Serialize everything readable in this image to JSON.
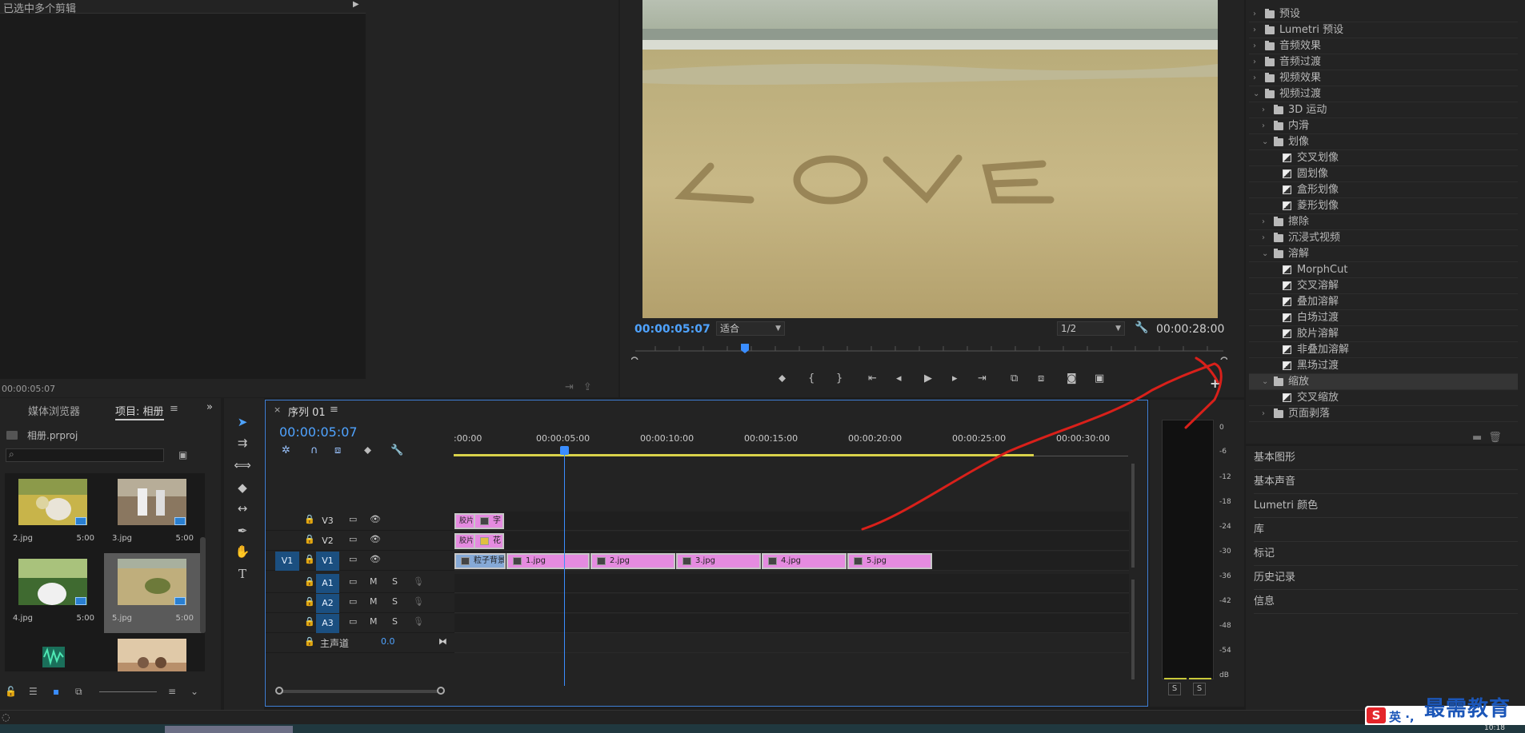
{
  "source_monitor": {
    "title": "已选中多个剪辑",
    "timecode": "00:00:05:07"
  },
  "program_monitor": {
    "timecode": "00:00:05:07",
    "fit": "适合",
    "resolution": "1/2",
    "duration": "00:00:28:00"
  },
  "effects": {
    "items": [
      {
        "label": "预设",
        "level": 0,
        "open": false,
        "type": "folder"
      },
      {
        "label": "Lumetri 预设",
        "level": 0,
        "open": false,
        "type": "folder"
      },
      {
        "label": "音频效果",
        "level": 0,
        "open": false,
        "type": "folder"
      },
      {
        "label": "音频过渡",
        "level": 0,
        "open": false,
        "type": "folder"
      },
      {
        "label": "视频效果",
        "level": 0,
        "open": false,
        "type": "folder"
      },
      {
        "label": "视频过渡",
        "level": 0,
        "open": true,
        "type": "folder"
      },
      {
        "label": "3D 运动",
        "level": 1,
        "open": false,
        "type": "folder"
      },
      {
        "label": "内滑",
        "level": 1,
        "open": false,
        "type": "folder"
      },
      {
        "label": "划像",
        "level": 1,
        "open": true,
        "type": "folder"
      },
      {
        "label": "交叉划像",
        "level": 2,
        "type": "transition"
      },
      {
        "label": "圆划像",
        "level": 2,
        "type": "transition"
      },
      {
        "label": "盒形划像",
        "level": 2,
        "type": "transition"
      },
      {
        "label": "菱形划像",
        "level": 2,
        "type": "transition"
      },
      {
        "label": "擦除",
        "level": 1,
        "open": false,
        "type": "folder"
      },
      {
        "label": "沉浸式视频",
        "level": 1,
        "open": false,
        "type": "folder"
      },
      {
        "label": "溶解",
        "level": 1,
        "open": true,
        "type": "folder"
      },
      {
        "label": "MorphCut",
        "level": 2,
        "type": "transition"
      },
      {
        "label": "交叉溶解",
        "level": 2,
        "type": "transition"
      },
      {
        "label": "叠加溶解",
        "level": 2,
        "type": "transition"
      },
      {
        "label": "白场过渡",
        "level": 2,
        "type": "transition"
      },
      {
        "label": "胶片溶解",
        "level": 2,
        "type": "transition"
      },
      {
        "label": "非叠加溶解",
        "level": 2,
        "type": "transition"
      },
      {
        "label": "黑场过渡",
        "level": 2,
        "type": "transition"
      },
      {
        "label": "缩放",
        "level": 1,
        "open": true,
        "type": "folder",
        "highlight": true
      },
      {
        "label": "交叉缩放",
        "level": 2,
        "type": "transition"
      },
      {
        "label": "页面剥落",
        "level": 1,
        "open": false,
        "type": "folder"
      }
    ]
  },
  "side_panels": [
    "基本图形",
    "基本声音",
    "Lumetri 颜色",
    "库",
    "标记",
    "历史记录",
    "信息"
  ],
  "project": {
    "tab_media": "媒体浏览器",
    "tab_project": "项目: 相册",
    "file": "相册.prproj",
    "search_placeholder": "",
    "items": [
      {
        "name": "2.jpg",
        "dur": "5:00"
      },
      {
        "name": "3.jpg",
        "dur": "5:00"
      },
      {
        "name": "4.jpg",
        "dur": "5:00"
      },
      {
        "name": "5.jpg",
        "dur": "5:00"
      }
    ]
  },
  "timeline": {
    "tab": "序列 01",
    "timecode": "00:00:05:07",
    "ruler": [
      ":00:00",
      "00:00:05:00",
      "00:00:10:00",
      "00:00:15:00",
      "00:00:20:00",
      "00:00:25:00",
      "00:00:30:00"
    ],
    "tracks": {
      "V3": "V3",
      "V2": "V2",
      "V1": "V1",
      "A1": "A1",
      "A2": "A2",
      "A3": "A3",
      "src_v1": "V1",
      "m": "M",
      "s": "S",
      "master": "主声道",
      "master_val": "0.0"
    },
    "clips": {
      "v3_a": "胶片",
      "v3_b": "字",
      "v2_a": "胶片",
      "v2_b": "花",
      "v1_bg": "粒子背景",
      "c1": "1.jpg",
      "c2": "2.jpg",
      "c3": "3.jpg",
      "c4": "4.jpg",
      "c5": "5.jpg"
    }
  },
  "meter": {
    "labels": [
      "0",
      "-6",
      "-12",
      "-18",
      "-24",
      "-30",
      "-36",
      "-42",
      "-48",
      "-54",
      "dB"
    ],
    "solo_left": "S",
    "solo_right": "S"
  },
  "ime": {
    "logo": "S",
    "text": "英 ·,"
  },
  "watermark": "最需教育",
  "clock": "10:18"
}
